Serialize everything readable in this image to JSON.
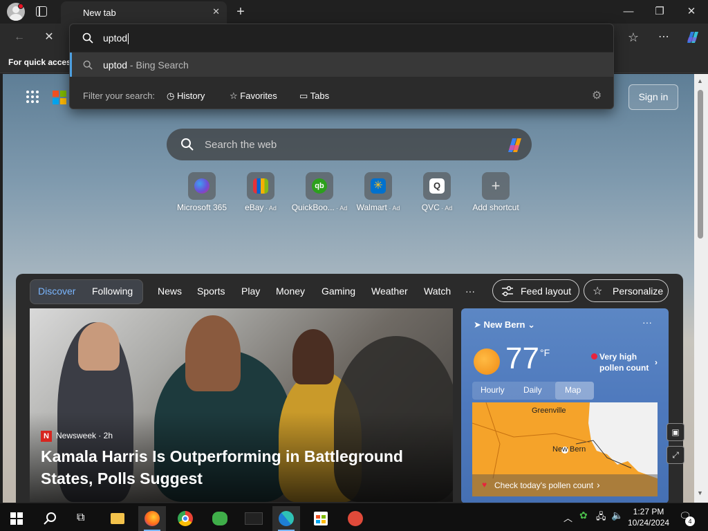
{
  "titlebar": {
    "tab_title": "New tab",
    "tab_close": "✕",
    "new_tab": "+",
    "minimize": "—",
    "maximize": "❐",
    "close": "✕"
  },
  "toolbar": {
    "back": "←",
    "stop": "✕",
    "favorites_icon": "☆",
    "more_icon": "⋯"
  },
  "favorites_bar": {
    "text": "For quick access"
  },
  "omnibox": {
    "query": "uptod",
    "suggestion_query": "uptod",
    "suggestion_suffix": " - Bing Search",
    "filter_label": "Filter your search:",
    "filters": [
      "History",
      "Favorites",
      "Tabs"
    ]
  },
  "page": {
    "sign_in": "Sign in",
    "search_placeholder": "Search the web",
    "shortcuts": [
      {
        "label": "Microsoft 365",
        "ad": "",
        "color": "#6b4fd8"
      },
      {
        "label": "eBay",
        "ad": " · Ad",
        "color": "#e53238"
      },
      {
        "label": "QuickBoo...",
        "ad": " · Ad",
        "color": "#2ca01c"
      },
      {
        "label": "Walmart",
        "ad": " · Ad",
        "color": "#0071ce"
      },
      {
        "label": "QVC",
        "ad": " · Ad",
        "color": "#ffffff"
      },
      {
        "label": "Add shortcut",
        "ad": "",
        "color": "#666666"
      }
    ]
  },
  "feed": {
    "nav_tabs": [
      "Discover",
      "Following"
    ],
    "nav_items": [
      "News",
      "Sports",
      "Play",
      "Money",
      "Gaming",
      "Weather",
      "Watch"
    ],
    "more": "···",
    "feed_layout": "Feed layout",
    "personalize": "Personalize",
    "hero": {
      "source_logo": "N",
      "source": "Newsweek · 2h",
      "headline": "Kamala Harris Is Outperforming in Battleground States, Polls Suggest"
    },
    "weather": {
      "location": "New Bern",
      "temp": "77",
      "unit": "°F",
      "pollen": "Very high pollen count",
      "tabs": [
        "Hourly",
        "Daily",
        "Map"
      ],
      "map_city_1": "Greenville",
      "map_city_2": "New Bern",
      "pollen_cta": "Check today's pollen count"
    }
  },
  "taskbar": {
    "time": "1:27 PM",
    "date": "10/24/2024",
    "notifications": "4"
  },
  "colors": {
    "accent": "#7ab6ff",
    "panel": "#2b2b2b",
    "weather": "#4e79bd"
  }
}
